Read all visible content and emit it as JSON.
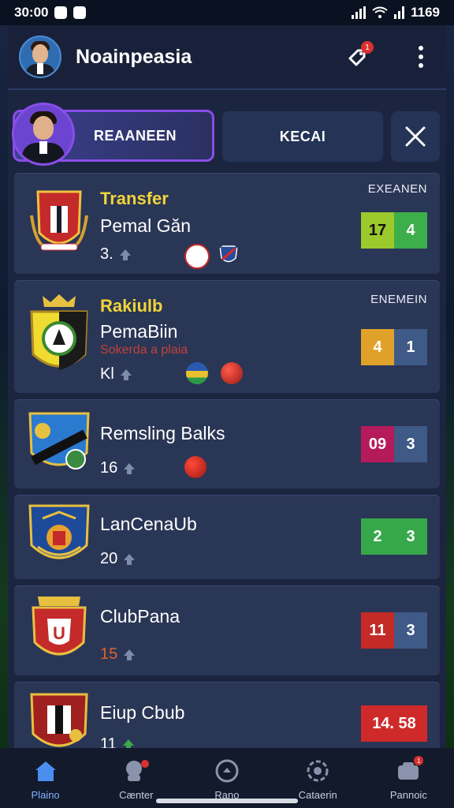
{
  "status_bar": {
    "time": "30:00",
    "battery_time": "1169"
  },
  "header": {
    "title": "Noainpeasia",
    "notif_count": "1"
  },
  "tabs": {
    "active_label": "REAANEEN",
    "second_label": "KECAI"
  },
  "matches": [
    {
      "tag": "Transfer",
      "name": "Pemal Găn",
      "subtitle": "",
      "rank": "3.",
      "status": "EXEANEN",
      "score": [
        "17",
        "4"
      ],
      "colors": [
        "#9cc92c",
        "#3cae4a"
      ]
    },
    {
      "tag": "Rakiulb",
      "name": "PemaBiin",
      "subtitle": "Sokerda a plaia",
      "rank": "Kl",
      "status": "ENEMEIN",
      "score": [
        "4",
        "1"
      ],
      "colors": [
        "#e0a12a",
        "#3f5a87"
      ]
    },
    {
      "tag": "",
      "name": "Remsling Balks",
      "subtitle": "",
      "rank": "16",
      "status": "",
      "score": [
        "09",
        "3"
      ],
      "colors": [
        "#b51b5a",
        "#3f5a87"
      ]
    },
    {
      "tag": "",
      "name": "LanCenaUb",
      "subtitle": "",
      "rank": "20",
      "status": "",
      "score": [
        "2",
        "3"
      ],
      "colors": [
        "#36a84a",
        "#36a84a"
      ]
    },
    {
      "tag": "",
      "name": "ClubPana",
      "subtitle": "",
      "rank": "15",
      "status": "",
      "score": [
        "11",
        "3"
      ],
      "colors": [
        "#c42a26",
        "#3f5a87"
      ]
    },
    {
      "tag": "",
      "name": "Eiup Cbub",
      "subtitle": "",
      "rank": "11",
      "status": "",
      "score": [
        "14. 58"
      ],
      "colors": [
        "#cf2a2a"
      ]
    }
  ],
  "nav": [
    {
      "label": "Plaino",
      "icon": "home-icon"
    },
    {
      "label": "Cænter",
      "icon": "community-icon"
    },
    {
      "label": "Rano",
      "icon": "ball-icon"
    },
    {
      "label": "Cataerin",
      "icon": "settings-icon"
    },
    {
      "label": "Pannoic",
      "icon": "profile-card-icon",
      "badge": "1"
    }
  ]
}
